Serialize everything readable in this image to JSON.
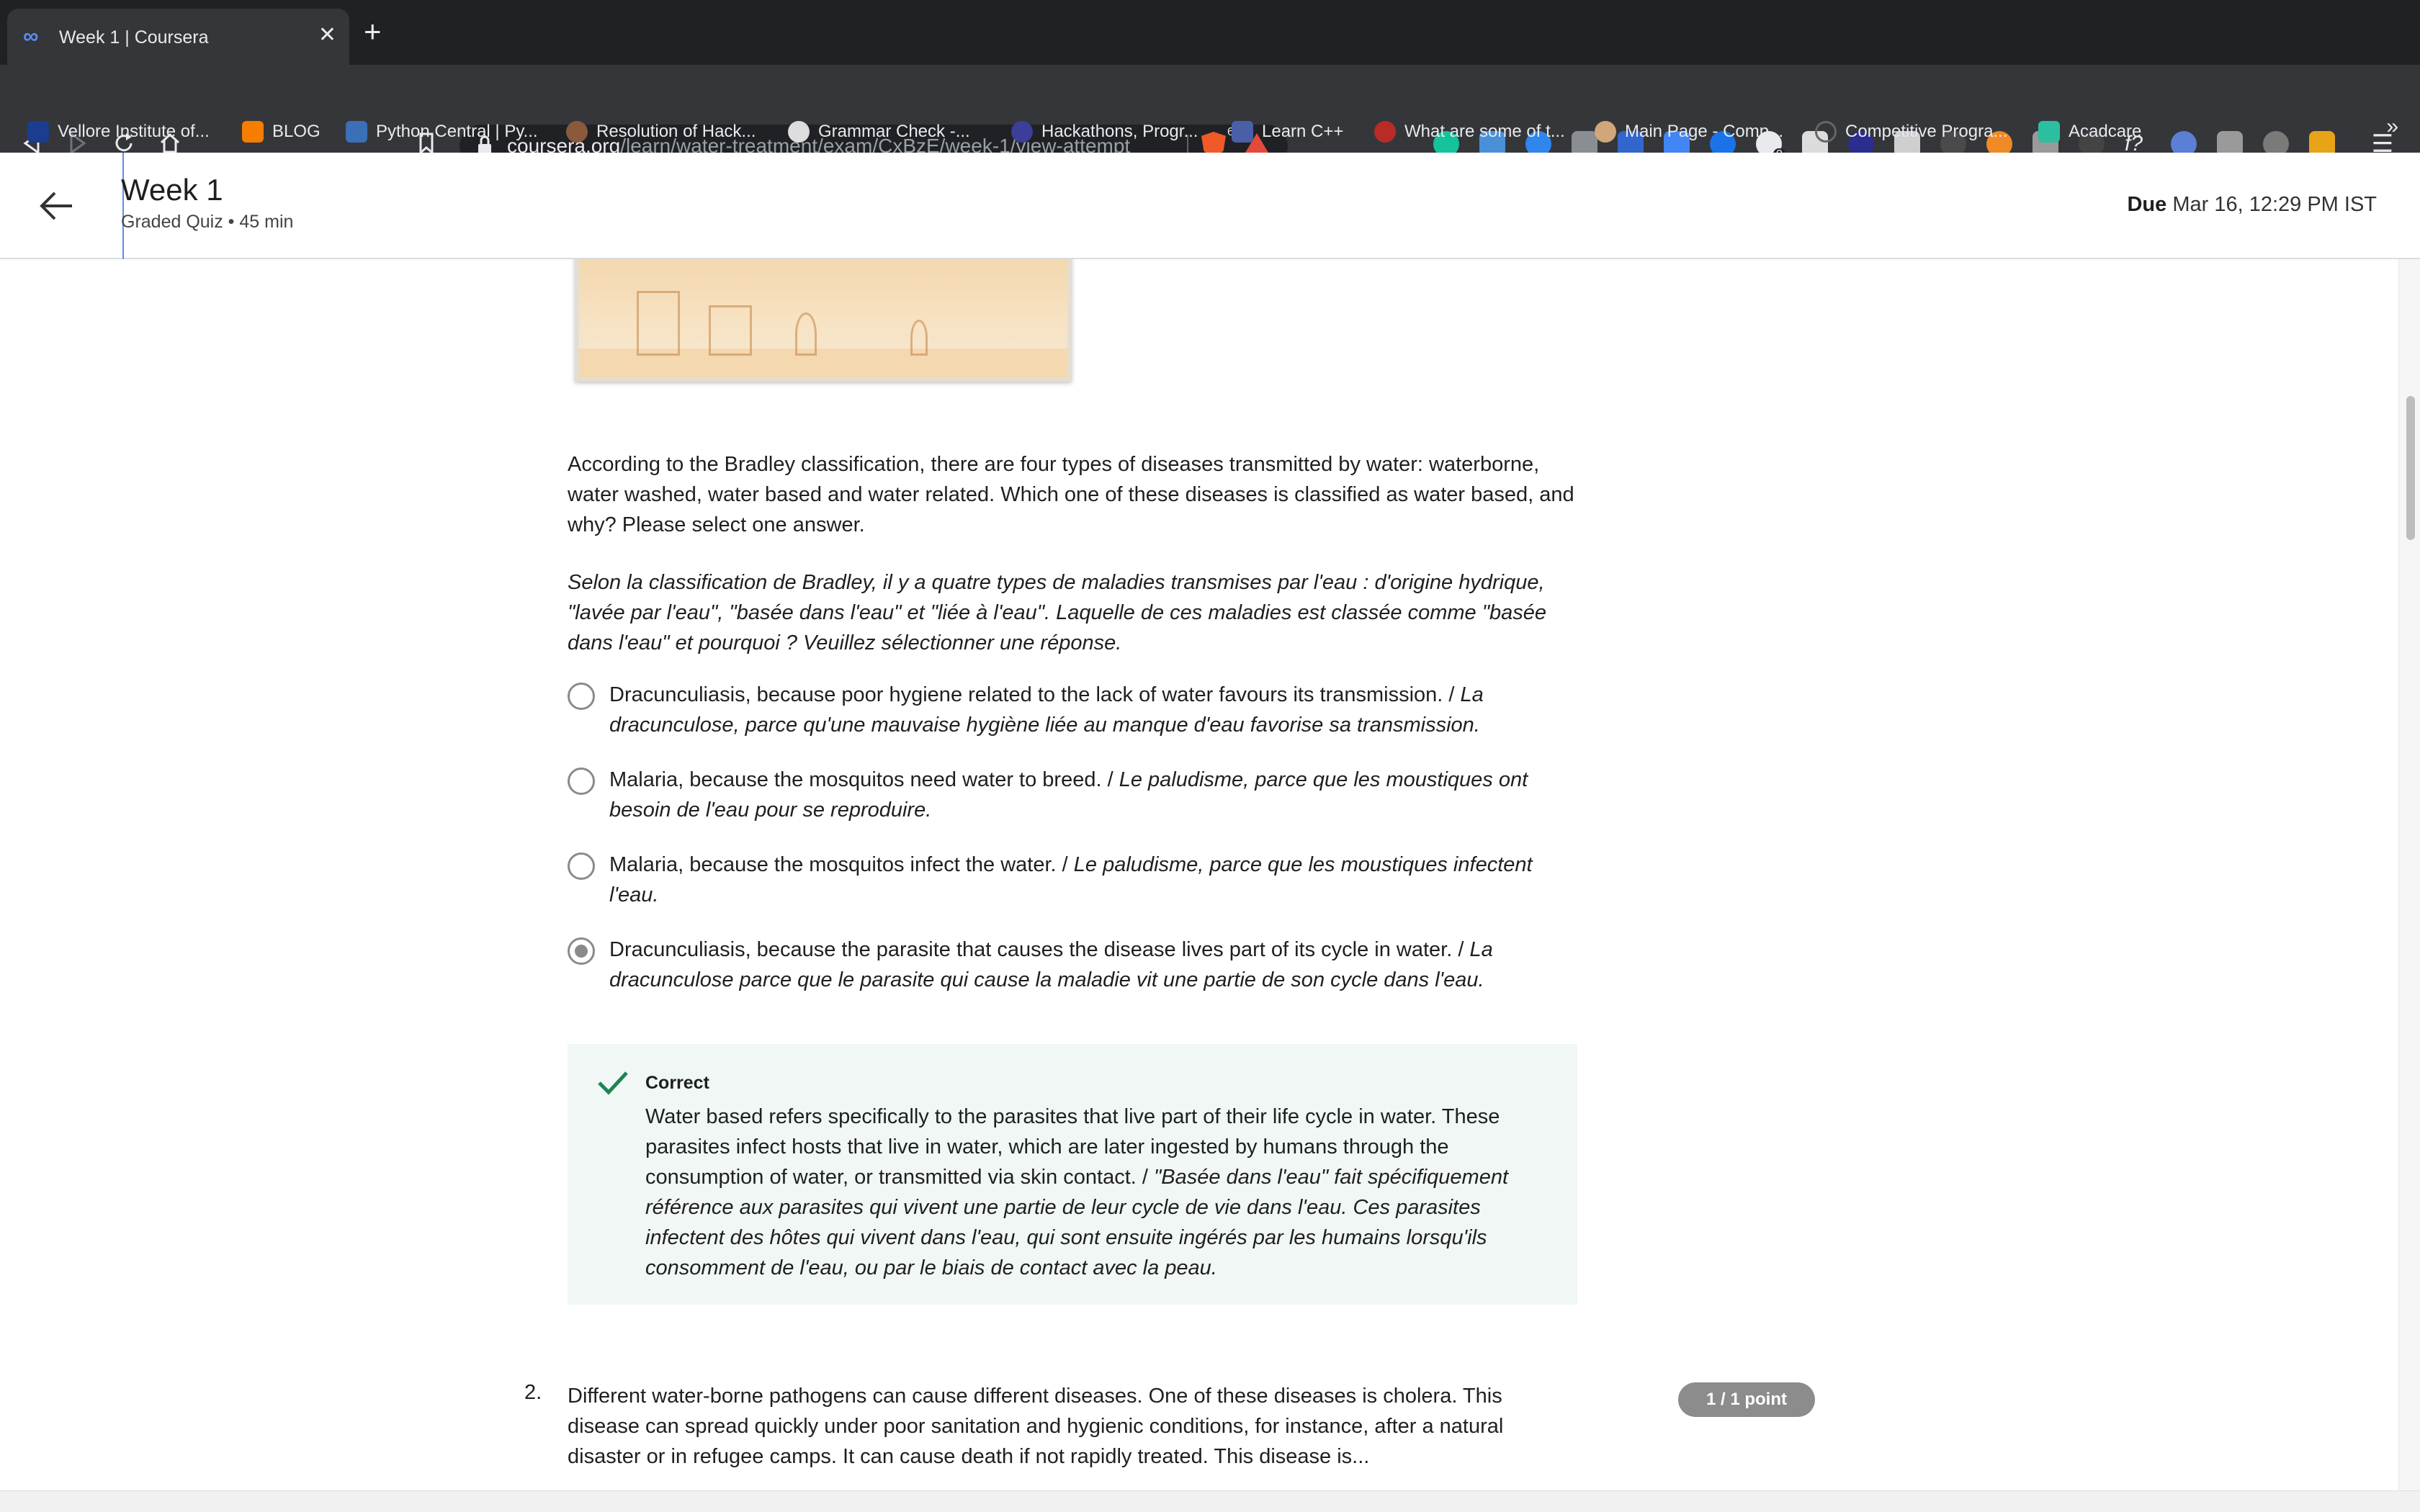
{
  "browser": {
    "tab_title": "Week 1 | Coursera",
    "url_host": "coursera.org",
    "url_path": "/learn/water-treatment/exam/CxBzE/week-1/view-attempt",
    "shield_count": "6",
    "extension_badge": "0",
    "bookmarks": [
      {
        "label": "Vellore Institute of...",
        "color": "#1a3d8f"
      },
      {
        "label": "BLOG",
        "color": "#f57d00"
      },
      {
        "label": "Python Central | Py...",
        "color": "#3b6fb6"
      },
      {
        "label": "Resolution of Hack...",
        "color": "#8b5a3c"
      },
      {
        "label": "Grammar Check -...",
        "color": "#dddddd"
      },
      {
        "label": "Hackathons, Progr...",
        "color": "#3b3f99"
      },
      {
        "label": "Learn C++",
        "color": "#4a5fa8"
      },
      {
        "label": "What are some of t...",
        "color": "#b92b27"
      },
      {
        "label": "Main Page - Comp...",
        "color": "#cfa77a"
      },
      {
        "label": "Competitive Progra...",
        "color": "#666666"
      },
      {
        "label": "Acadcare",
        "color": "#2bbfa0"
      }
    ]
  },
  "header": {
    "title": "Week 1",
    "subtitle": "Graded Quiz • 45 min",
    "due_label": "Due",
    "due_value": "Mar 16, 12:29 PM IST"
  },
  "question1": {
    "text_en": "According to the Bradley classification, there are four types of diseases transmitted by water: waterborne, water washed, water based and water related. Which one of these diseases is classified as water based, and why? Please select one answer.",
    "text_fr": "Selon la classification de Bradley, il y a quatre types de maladies transmises par l'eau : d'origine hydrique, \"lavée par l'eau\", \"basée dans l'eau\" et \"liée à l'eau\". Laquelle de ces maladies est classée comme \"basée dans l'eau\" et pourquoi ? Veuillez sélectionner une réponse.",
    "options": [
      {
        "en": "Dracunculiasis, because poor hygiene related to the lack of water favours its transmission. / ",
        "fr": "La dracunculose, parce qu'une mauvaise hygiène liée au manque d'eau favorise sa transmission."
      },
      {
        "en": "Malaria, because the mosquitos need water to breed. / ",
        "fr": "Le paludisme, parce que les moustiques ont besoin de l'eau pour se reproduire."
      },
      {
        "en": "Malaria, because the mosquitos infect the water. / ",
        "fr": "Le paludisme, parce que les moustiques infectent l'eau."
      },
      {
        "en": "Dracunculiasis, because the parasite that causes the disease lives part of its cycle in water. / ",
        "fr": "La dracunculose parce que le parasite qui cause la maladie vit une partie de son cycle dans l'eau."
      }
    ],
    "feedback": {
      "title": "Correct",
      "text_en": "Water based refers specifically to the parasites that live part of their life cycle in water. These parasites infect hosts that live in water, which are later ingested by humans through the consumption of water, or transmitted via skin contact. / ",
      "text_fr": "\"Basée dans l'eau\" fait spécifiquement référence aux parasites qui vivent une partie de leur cycle de vie dans l'eau. Ces parasites infectent des hôtes qui vivent dans l'eau, qui sont ensuite ingérés par les humains lorsqu'ils consomment de l'eau, ou par le biais de contact avec la peau."
    }
  },
  "question2": {
    "number": "2.",
    "text": "Different water-borne pathogens can cause different diseases. One of these diseases is cholera. This disease can spread quickly under poor sanitation and hygienic conditions, for instance, after a natural disaster or in refugee camps. It can cause death if not rapidly treated. This disease is...",
    "points": "1 / 1 point"
  }
}
